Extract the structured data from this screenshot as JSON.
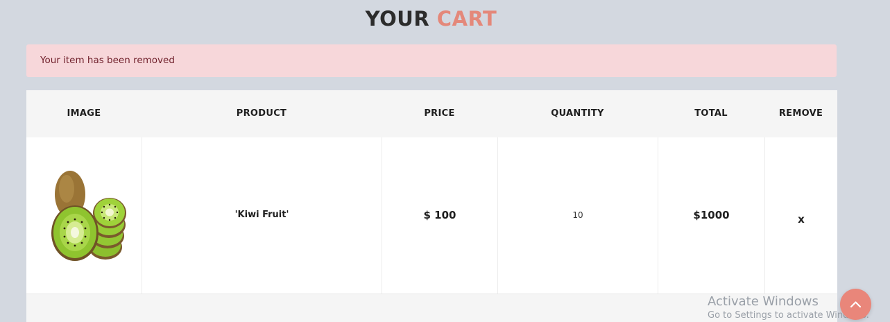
{
  "page": {
    "title_part1": "YOUR",
    "title_part2": "CART",
    "accent_color": "#e4887a"
  },
  "alert": {
    "message": "Your item has been removed",
    "color": "#f7d7da"
  },
  "table": {
    "headers": [
      "IMAGE",
      "PRODUCT",
      "PRICE",
      "QUANTITY",
      "TOTAL",
      "REMOVE"
    ],
    "rows": [
      {
        "image_icon": "kiwi-fruit-image",
        "product": "'Kiwi Fruit'",
        "price": "$ 100",
        "quantity": "10",
        "total": "$1000",
        "remove": "x"
      }
    ]
  },
  "os_overlay": {
    "line1": "Activate Windows",
    "line2": "Go to Settings to activate Windows."
  },
  "scroll_top": {
    "icon": "chevron-up-icon"
  }
}
